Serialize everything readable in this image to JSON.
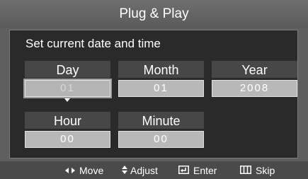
{
  "title": "Plug & Play",
  "prompt": "Set current date and time",
  "fields": {
    "day": {
      "label": "Day",
      "value": "01"
    },
    "month": {
      "label": "Month",
      "value": "01"
    },
    "year": {
      "label": "Year",
      "value": "2008"
    },
    "hour": {
      "label": "Hour",
      "value": "00"
    },
    "minute": {
      "label": "Minute",
      "value": "00"
    }
  },
  "help": {
    "move": "Move",
    "adjust": "Adjust",
    "enter": "Enter",
    "skip": "Skip"
  },
  "icons": {
    "move": "left-right-arrows-icon",
    "adjust": "up-down-arrows-icon",
    "enter": "enter-icon",
    "skip": "skip-icon"
  },
  "colors": {
    "background": "#5f5f5f",
    "panel": "#2a2a2a",
    "label_bg": "#474747",
    "value_bg": "#b8b8b8",
    "help_bar": "#4a4a4a"
  }
}
